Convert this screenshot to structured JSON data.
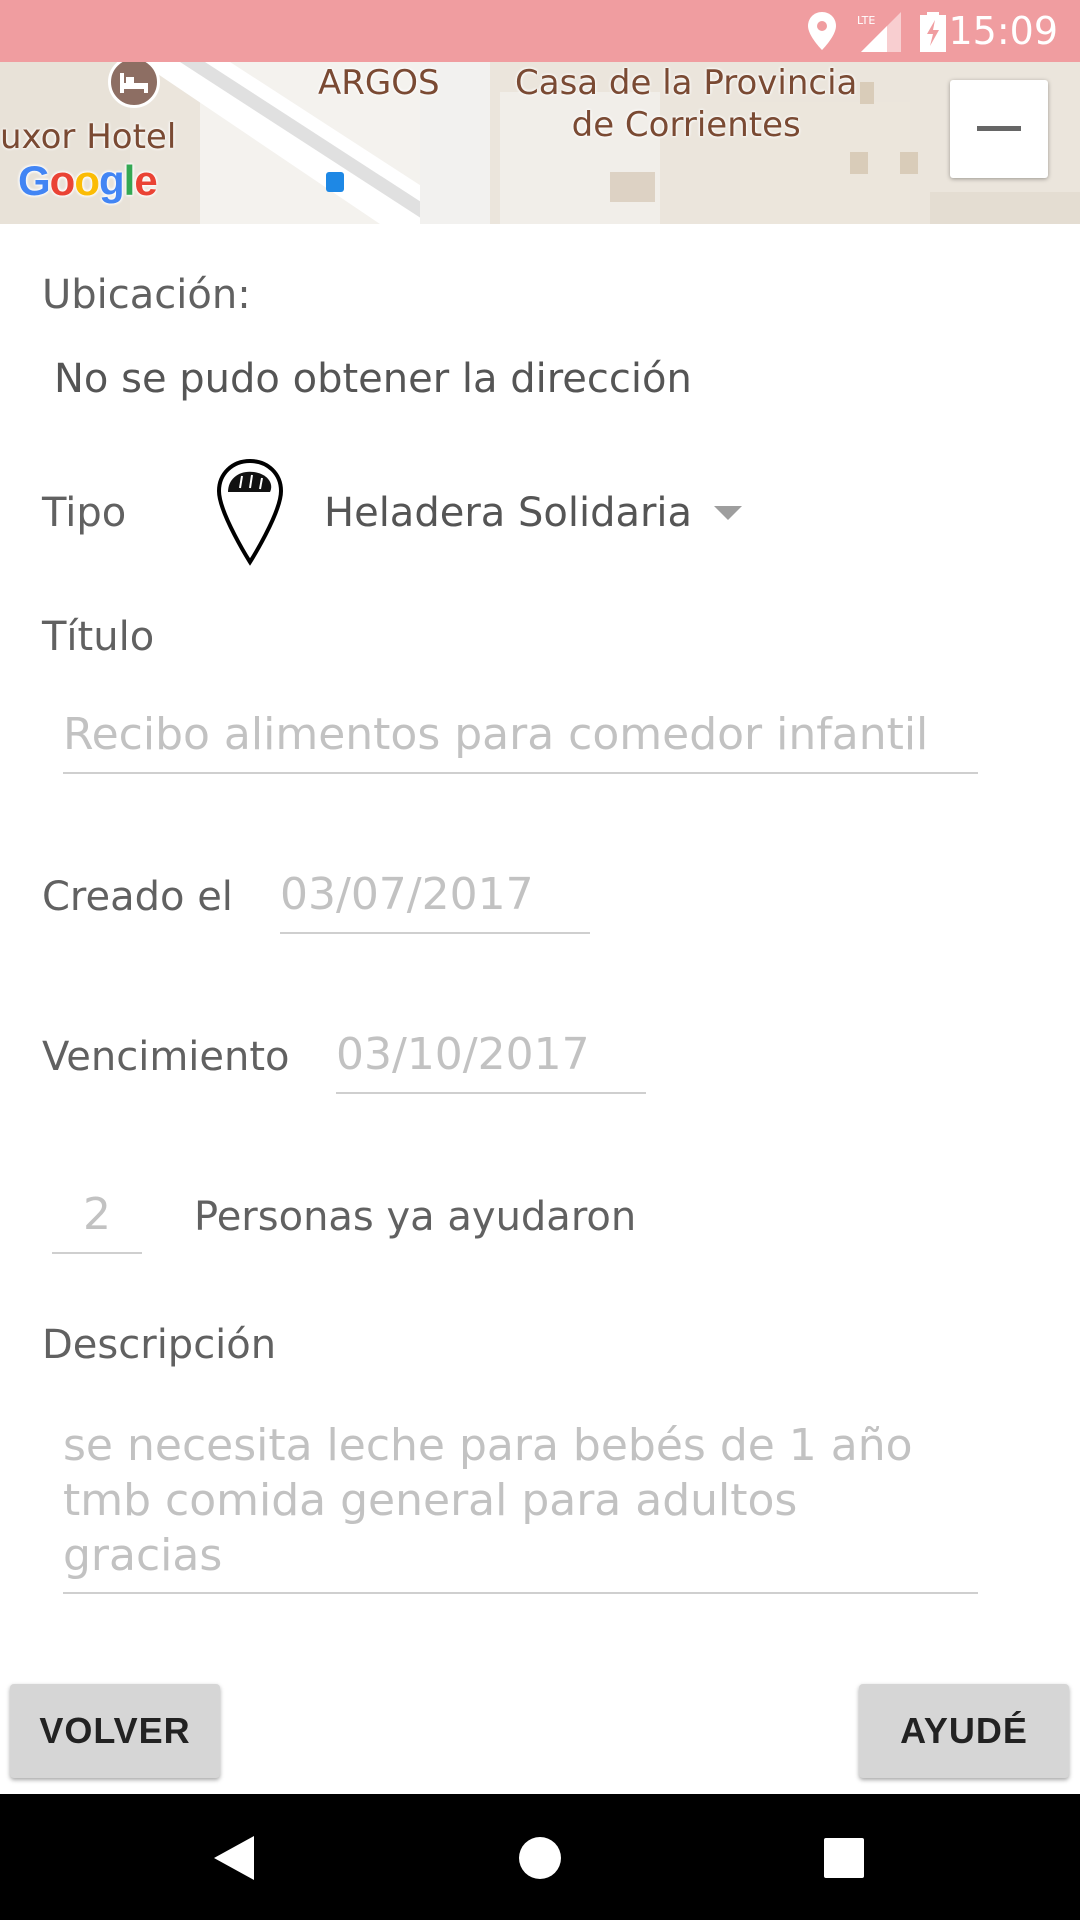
{
  "status_bar": {
    "time": "15:09",
    "network": "LTE",
    "icons": [
      "location-icon",
      "signal-icon",
      "battery-charging-icon"
    ],
    "background": "#f09da0"
  },
  "map": {
    "labels": {
      "hotel": "uxor Hotel",
      "argos": "ARGOS",
      "casa_line1": "Casa de la Provincia",
      "casa_line2": "de Corrientes"
    },
    "logo": "Google",
    "zoom_out_symbol": "−"
  },
  "form": {
    "ubicacion_label": "Ubicación:",
    "ubicacion_value": "No se pudo obtener la dirección",
    "tipo_label": "Tipo",
    "tipo_value": "Heladera Solidaria",
    "tipo_icon": "bread-map-pin-icon",
    "titulo_label": "Título",
    "titulo_placeholder": "Recibo alimentos para comedor infantil",
    "creado_label": "Creado el",
    "creado_value": "03/07/2017",
    "vencimiento_label": "Vencimiento",
    "vencimiento_value": "03/10/2017",
    "ayudaron_count": "2",
    "ayudaron_label": "Personas ya ayudaron",
    "descripcion_label": "Descripción",
    "descripcion_lines": [
      "se necesita leche para bebés de 1 año",
      "tmb comida general para adultos",
      "gracias"
    ]
  },
  "buttons": {
    "volver": "VOLVER",
    "ayude": "AYUDÉ"
  },
  "nav_bar": {
    "icons": [
      "back-icon",
      "home-icon",
      "recents-icon"
    ]
  }
}
